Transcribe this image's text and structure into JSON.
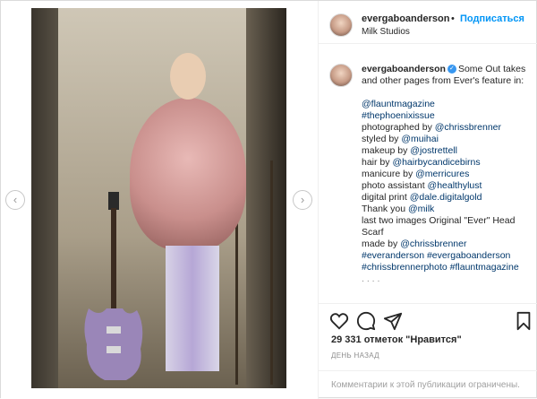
{
  "post": {
    "username": "evergaboanderson",
    "dot": "•",
    "follow_label": "Подписаться",
    "location": "Milk Studios"
  },
  "caption": {
    "username": "evergaboanderson",
    "lines": [
      "Some Out takes and other pages from Ever's feature in:",
      "",
      "@flauntmagazine",
      "#thephoenixissue",
      "photographed by @chrissbrenner",
      "styled by @muihai",
      "makeup by @jostrettell",
      "hair by @hairbycandicebirns",
      "manicure by @merricures",
      "photo assistant @healthylust",
      "digital print @dale.digitalgold",
      "Thank you @milk",
      "last two images Original \"Ever\" Head Scarf",
      "made by @chrissbrenner",
      "#everanderson #evergaboanderson",
      "#chrissbrennerphoto #flauntmagazine"
    ],
    "intro": "Some Out takes and other pages from Ever's feature in:",
    "l1": "@flauntmagazine",
    "l2": "#thephoenixissue",
    "l3a": "photographed by ",
    "l3b": "@chrissbrenner",
    "l4a": "styled by ",
    "l4b": "@muihai",
    "l5a": "makeup by ",
    "l5b": "@jostrettell",
    "l6a": "hair by ",
    "l6b": "@hairbycandicebirns",
    "l7a": "manicure by ",
    "l7b": "@merricures",
    "l8a": "photo assistant ",
    "l8b": "@healthylust",
    "l9a": "digital print ",
    "l9b": "@dale.digitalgold",
    "l10a": "Thank you ",
    "l10b": "@milk",
    "l11": "last two images Original \"Ever\" Head Scarf",
    "l12a": "made by ",
    "l12b": "@chrissbrenner",
    "l13": "#everanderson #evergaboanderson",
    "l14": "#chrissbrennerphoto #flauntmagazine",
    "more": ". . . ."
  },
  "icons": {
    "like": "heart-icon",
    "comment": "comment-icon",
    "share": "send-icon",
    "save": "bookmark-icon",
    "verified": "verified-badge-icon",
    "prev": "chevron-left-icon",
    "next": "chevron-right-icon"
  },
  "stats": {
    "likes": "29 331 отметок \"Нравится\"",
    "date": "ДЕНЬ НАЗАД"
  },
  "comments": {
    "disabled_text": "Комментарии к этой публикации ограничены."
  },
  "colors": {
    "link": "#00376b",
    "follow": "#0095f6",
    "verified": "#3897f0",
    "muted": "#8e8e8e"
  }
}
